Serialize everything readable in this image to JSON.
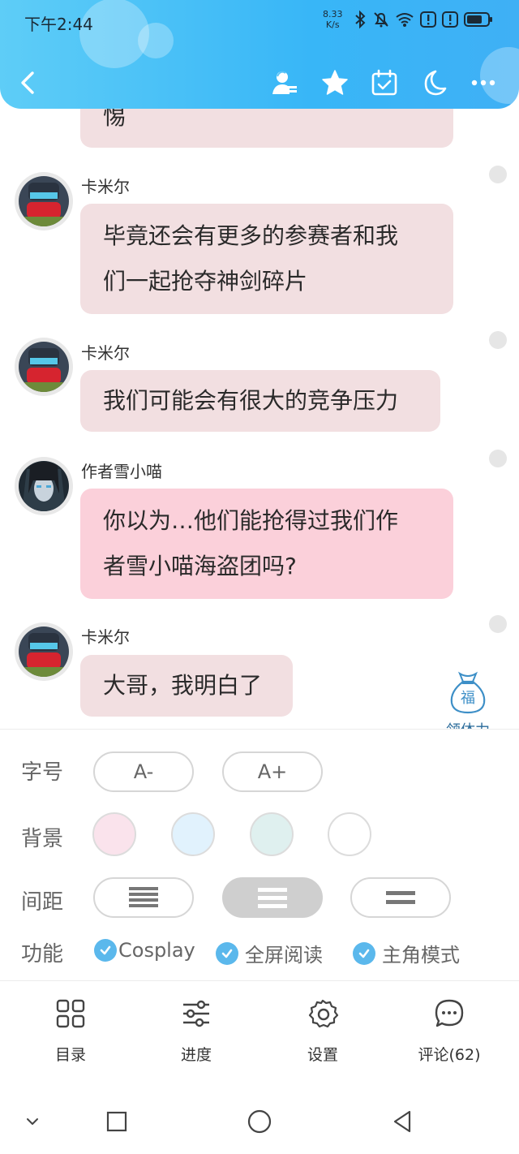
{
  "status_bar": {
    "time": "下午2:44",
    "net_speed_value": "8.33",
    "net_speed_unit": "K/s",
    "icons": [
      "bluetooth-icon",
      "mute-bell-icon",
      "wifi-icon",
      "alert-icon",
      "alert-icon",
      "battery-icon"
    ]
  },
  "toolbar": {
    "icons": [
      "back-icon",
      "user-share-icon",
      "star-icon",
      "calendar-check-icon",
      "moon-icon",
      "more-icon"
    ]
  },
  "chat": {
    "partial_text": "惕",
    "messages": [
      {
        "sender": "卡米尔",
        "line1": "毕竟还会有更多的参赛者和我",
        "line2": "们一起抢夺神剑碎片"
      },
      {
        "sender": "卡米尔",
        "line1": "我们可能会有很大的竞争压力"
      },
      {
        "sender": "作者雪小喵",
        "line1": "你以为…他们能抢得过我们作",
        "line2": "者雪小喵海盗团吗?"
      },
      {
        "sender": "卡米尔",
        "line1": "大哥，我明白了"
      }
    ]
  },
  "reward": {
    "label": "领体力",
    "bag_char": "福"
  },
  "settings": {
    "font_size": {
      "label": "字号",
      "decrease": "A-",
      "increase": "A+"
    },
    "background": {
      "label": "背景",
      "colors": [
        "#fae3ec",
        "#e1f2fd",
        "#dff0ef",
        "#ffffff"
      ]
    },
    "spacing": {
      "label": "间距"
    },
    "features": {
      "label": "功能",
      "items": [
        "Cosplay",
        "全屏阅读",
        "主角模式"
      ]
    }
  },
  "bottom_nav": {
    "items": [
      {
        "label": "目录",
        "icon": "grid-icon"
      },
      {
        "label": "进度",
        "icon": "sliders-icon"
      },
      {
        "label": "设置",
        "icon": "gear-icon"
      },
      {
        "label": "评论(62)",
        "icon": "comment-icon"
      }
    ]
  },
  "colors": {
    "header_start": "#5ecdf7",
    "header_end": "#3fb0f5",
    "bubble": "#f2dfe1",
    "author_bubble": "#fbd0da",
    "check": "#5bb8ec"
  }
}
